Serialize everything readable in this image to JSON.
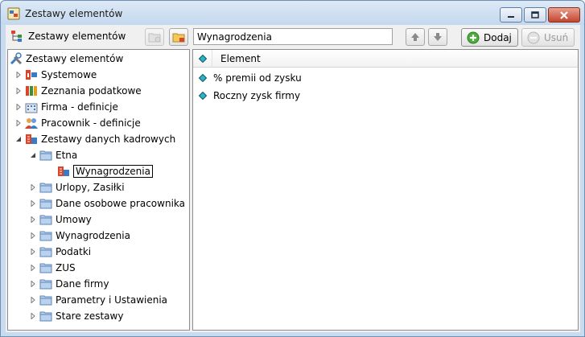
{
  "window": {
    "title": "Zestawy elementów"
  },
  "toolbar": {
    "label": "Zestawy elementów",
    "path_value": "Wynagrodzenia",
    "add_label": "Dodaj",
    "remove_label": "Usuń"
  },
  "tree": {
    "root": "Zestawy elementów",
    "items": [
      {
        "label": "Systemowe"
      },
      {
        "label": "Zeznania podatkowe"
      },
      {
        "label": "Firma - definicje"
      },
      {
        "label": "Pracownik - definicje"
      },
      {
        "label": "Zestawy danych kadrowych"
      },
      {
        "label": "Etna"
      },
      {
        "label": "Wynagrodzenia"
      },
      {
        "label": "Urlopy, Zasiłki"
      },
      {
        "label": "Dane osobowe pracownika"
      },
      {
        "label": "Umowy"
      },
      {
        "label": "Wynagrodzenia"
      },
      {
        "label": "Podatki"
      },
      {
        "label": "ZUS"
      },
      {
        "label": "Dane firmy"
      },
      {
        "label": "Parametry i Ustawienia"
      },
      {
        "label": "Stare zestawy"
      }
    ]
  },
  "list": {
    "header": "Element",
    "rows": [
      {
        "text": "% premii od zysku"
      },
      {
        "text": "Roczny zysk firmy"
      }
    ]
  }
}
